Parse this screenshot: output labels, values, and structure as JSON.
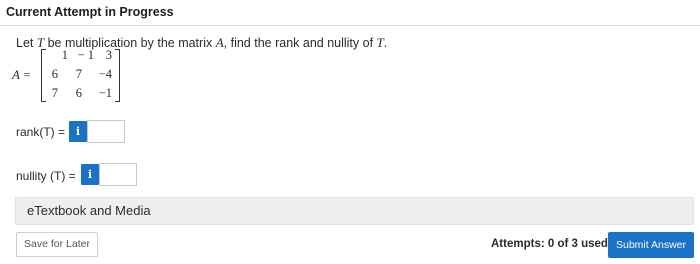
{
  "header": {
    "title": "Current Attempt in Progress"
  },
  "question": {
    "text_before": "Let ",
    "var_T": "T",
    "text_mid": " be multiplication by the matrix ",
    "var_A": "A",
    "text_after": ", find the rank and nullity of ",
    "var_T2": "T",
    "text_end": "."
  },
  "matrix": {
    "label_var": "A",
    "label_eq": " =",
    "rows": [
      [
        "1",
        "− 1",
        "3"
      ],
      [
        "6",
        "7",
        "−4"
      ],
      [
        "7",
        "6",
        "−1"
      ]
    ]
  },
  "rank": {
    "label": "rank(T) =",
    "info_icon": "i",
    "value": ""
  },
  "nullity": {
    "label": "nullity (T) =",
    "info_icon": "i",
    "value": ""
  },
  "etextbook": {
    "label": "eTextbook and Media"
  },
  "footer": {
    "save_label": "Save for Later",
    "attempts_text": "Attempts: 0 of 3 used",
    "submit_label": "Submit Answer"
  },
  "colors": {
    "accent": "#1a73c7",
    "panel_bg": "#efefef"
  }
}
